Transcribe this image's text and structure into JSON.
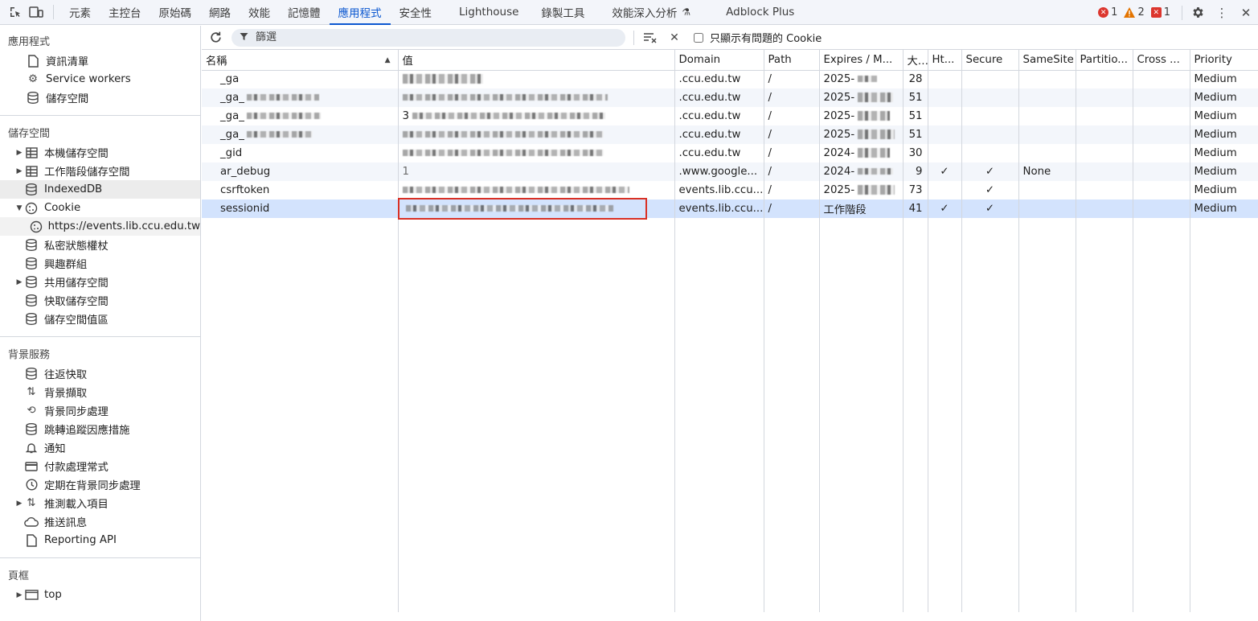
{
  "top_tabs": [
    {
      "label": "元素"
    },
    {
      "label": "主控台"
    },
    {
      "label": "原始碼"
    },
    {
      "label": "網路"
    },
    {
      "label": "效能"
    },
    {
      "label": "記憶體"
    },
    {
      "label": "應用程式",
      "active": true
    },
    {
      "label": "安全性"
    },
    {
      "label": "Lighthouse"
    },
    {
      "label": "錄製工具"
    },
    {
      "label": "效能深入分析"
    },
    {
      "label": "Adblock Plus"
    }
  ],
  "status": {
    "errors": "1",
    "warnings": "2",
    "issues": "1"
  },
  "sidebar": {
    "app_section": {
      "title": "應用程式",
      "items": [
        "資訊清單",
        "Service workers",
        "儲存空間"
      ]
    },
    "storage_section": {
      "title": "儲存空間",
      "items": [
        "本機儲存空間",
        "工作階段儲存空間",
        "IndexedDB",
        "Cookie",
        "https://events.lib.ccu.edu.tw",
        "私密狀態權杖",
        "興趣群組",
        "共用儲存空間",
        "快取儲存空間",
        "儲存空間值區"
      ]
    },
    "bg_section": {
      "title": "背景服務",
      "items": [
        "往返快取",
        "背景擷取",
        "背景同步處理",
        "跳轉追蹤因應措施",
        "通知",
        "付款處理常式",
        "定期在背景同步處理",
        "推測載入項目",
        "推送訊息",
        "Reporting API"
      ]
    },
    "frames_section": {
      "title": "頁框",
      "items": [
        "top"
      ]
    }
  },
  "toolbar": {
    "filter_placeholder": "篩選",
    "only_issues_label": "只顯示有問題的 Cookie"
  },
  "table": {
    "headers": [
      "名稱",
      "值",
      "Domain",
      "Path",
      "Expires / M...",
      "大...",
      "Ht...",
      "Secure",
      "SameSite",
      "Partitio...",
      "Cross ...",
      "Priority"
    ],
    "rows": [
      {
        "name": "_ga",
        "value": "",
        "domain": ".ccu.edu.tw",
        "path": "/",
        "expires": "2025-",
        "size": "28",
        "http": "",
        "secure": "",
        "samesite": "",
        "priority": "Medium"
      },
      {
        "name": "_ga_",
        "value": "",
        "domain": ".ccu.edu.tw",
        "path": "/",
        "expires": "2025-",
        "size": "51",
        "http": "",
        "secure": "",
        "samesite": "",
        "priority": "Medium"
      },
      {
        "name": "_ga_",
        "value": "3",
        "domain": ".ccu.edu.tw",
        "path": "/",
        "expires": "2025-",
        "size": "51",
        "http": "",
        "secure": "",
        "samesite": "",
        "priority": "Medium"
      },
      {
        "name": "_ga_",
        "value": "",
        "domain": ".ccu.edu.tw",
        "path": "/",
        "expires": "2025-",
        "size": "51",
        "http": "",
        "secure": "",
        "samesite": "",
        "priority": "Medium"
      },
      {
        "name": "_gid",
        "value": "",
        "domain": ".ccu.edu.tw",
        "path": "/",
        "expires": "2024-",
        "size": "30",
        "http": "",
        "secure": "",
        "samesite": "",
        "priority": "Medium"
      },
      {
        "name": "ar_debug",
        "value": "1",
        "domain": ".www.google...",
        "path": "/",
        "expires": "2024-",
        "size": "9",
        "http": "✓",
        "secure": "✓",
        "samesite": "None",
        "priority": "Medium"
      },
      {
        "name": "csrftoken",
        "value": "",
        "domain": "events.lib.ccu...",
        "path": "/",
        "expires": "2025-",
        "size": "73",
        "http": "",
        "secure": "✓",
        "samesite": "",
        "priority": "Medium"
      },
      {
        "name": "sessionid",
        "value": "",
        "domain": "events.lib.ccu...",
        "path": "/",
        "expires": "工作階段",
        "size": "41",
        "http": "✓",
        "secure": "✓",
        "samesite": "",
        "priority": "Medium"
      }
    ]
  }
}
